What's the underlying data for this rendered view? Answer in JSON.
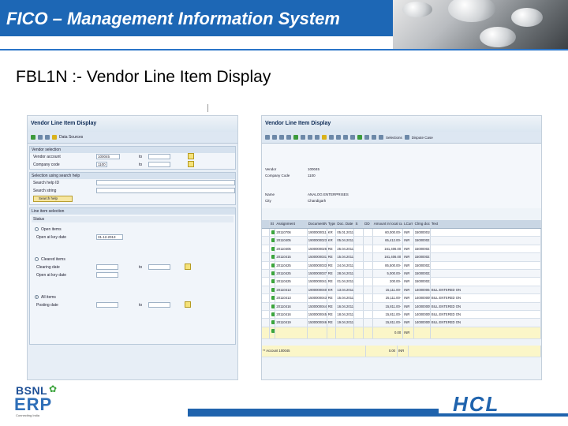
{
  "header": {
    "title": "FICO – Management Information System"
  },
  "subtitle": "FBL1N :- Vendor Line Item Display",
  "colors": {
    "brand_blue": "#1d67b5",
    "footer_blue": "#1f63ad",
    "sap_bg": "#e7eef6"
  },
  "left_screen": {
    "title": "Vendor Line Item Display",
    "toolbar_label": "Data Sources",
    "vendor_section": "Vendor selection",
    "vendor_account_label": "Vendor account",
    "vendor_account_value": "100045",
    "company_code_label": "Company code",
    "company_code_value": "1100",
    "to_label": "to",
    "search_section": "Selection using search help",
    "search_help_id_label": "Search help ID",
    "search_string_label": "Search string",
    "search_help_button": "Search help",
    "line_item_section": "Line item selection",
    "status_label": "Status",
    "open_items_label": "Open items",
    "open_at_key_date_label": "Open at key date",
    "open_at_key_date_value": "31.12.2013",
    "cleared_items_label": "Cleared items",
    "clearing_date_label": "Clearing date",
    "open_at_key_date_label2": "Open at key date",
    "all_items_label": "All items",
    "posting_date_label": "Posting date"
  },
  "right_screen": {
    "title": "Vendor Line Item Display",
    "toolbar_selections": "Selections",
    "toolbar_dispute": "Dispute Case",
    "info": {
      "vendor_label": "Vendor",
      "vendor_value": "100045",
      "company_code_label": "Company Code",
      "company_code_value": "1100",
      "name_label": "Name",
      "name_value": "ANALOG ENTERPRISES",
      "city_label": "City",
      "city_value": "Chandigarh"
    },
    "columns": [
      "St",
      "Assignment",
      "DocumentNo",
      "Type",
      "Doc. Date",
      "S",
      "DD",
      "Amount in local cur.",
      "LCurr",
      "Clrng doc.",
      "Text"
    ],
    "rows": [
      [
        "20110706",
        "1900000011",
        "KR",
        "05.01.2011",
        "",
        "",
        "60,000.00-",
        "INR",
        "1500000197",
        ""
      ],
      [
        "20110405",
        "1900000023",
        "KR",
        "05.04.2011",
        "",
        "",
        "65,412.00-",
        "INR",
        "1500000211",
        ""
      ],
      [
        "20110405",
        "1500000026",
        "RE",
        "25.04.2011",
        "",
        "",
        "161,406.00",
        "INR",
        "1500000215",
        ""
      ],
      [
        "20110415",
        "1500000031",
        "RE",
        "15.04.2011",
        "",
        "",
        "161,406.00",
        "INR",
        "1500000216",
        ""
      ],
      [
        "20110425",
        "1500000033",
        "RE",
        "24.04.2011",
        "",
        "",
        "85,500.00-",
        "INR",
        "1500000221",
        ""
      ],
      [
        "20110425",
        "1500000037",
        "RE",
        "28.04.2011",
        "",
        "",
        "5,000.00-",
        "INR",
        "1500000225",
        ""
      ],
      [
        "20110425",
        "1500000041",
        "RE",
        "01.04.2011",
        "",
        "",
        "200.00-",
        "INR",
        "1500000232",
        ""
      ],
      [
        "20110413",
        "1900000040",
        "KR",
        "13.04.2011",
        "",
        "",
        "15,111.00-",
        "INR",
        "1400000049",
        "BILL ENTERED ON"
      ],
      [
        "20110413",
        "1500000043",
        "RE",
        "15.04.2011",
        "",
        "",
        "25,111.00-",
        "INR",
        "1400000050",
        "BILL ENTERED ON"
      ],
      [
        "20110416",
        "1500000044",
        "RE",
        "16.04.2011",
        "",
        "",
        "15,811.00-",
        "INR",
        "1400000051",
        "BILL ENTERED ON"
      ],
      [
        "20110416",
        "1500000045",
        "RE",
        "18.04.2011",
        "",
        "",
        "15,811.00-",
        "INR",
        "1400000052",
        "BILL ENTERED ON"
      ],
      [
        "20110419",
        "1500000046",
        "RE",
        "19.04.2011",
        "",
        "",
        "15,811.00-",
        "INR",
        "1400000053",
        "BILL ENTERED ON"
      ]
    ],
    "subtotal_amount": "0.00",
    "subtotal_currency": "INR",
    "total_label": "** Account 100045",
    "total_amount": "0.00",
    "total_currency": "INR"
  },
  "footer": {
    "bsnl": "BSNL",
    "erp": "ERP",
    "tagline": "Connecting India",
    "hcl": "HCL"
  }
}
